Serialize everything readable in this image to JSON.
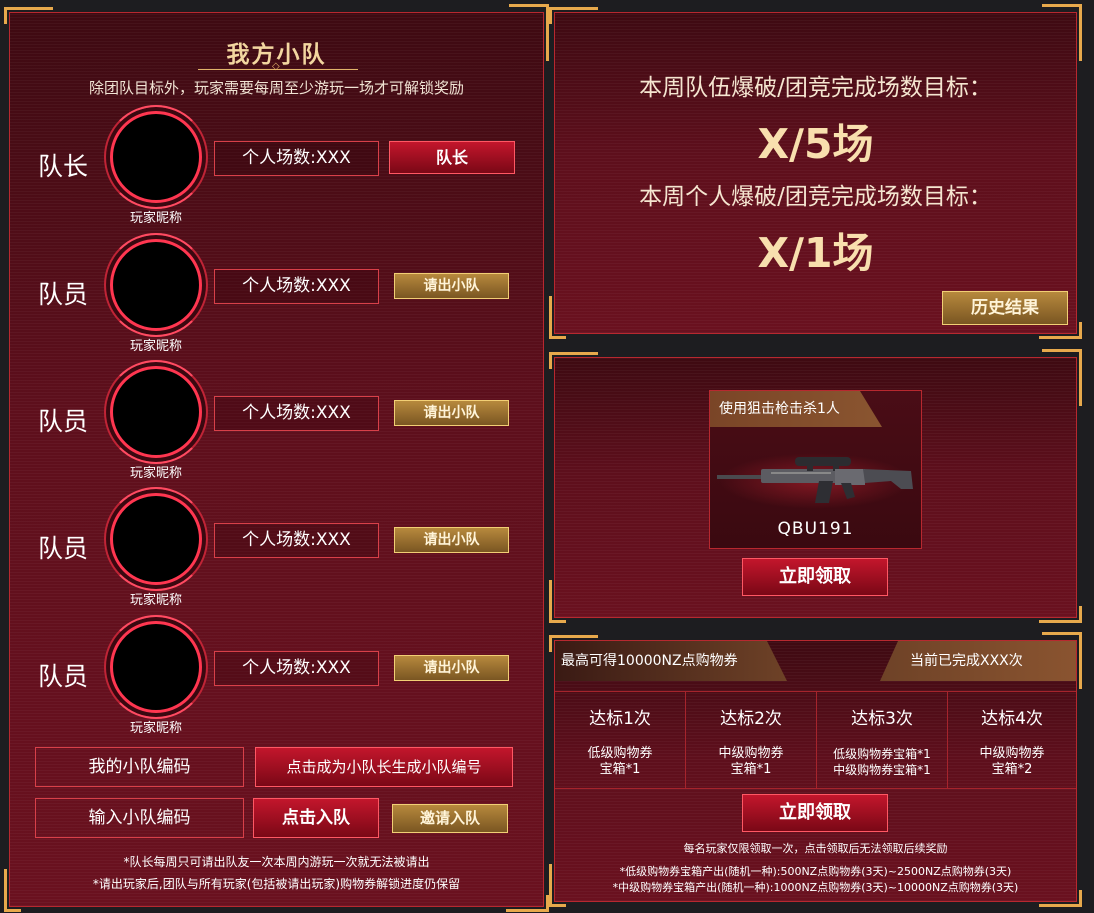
{
  "squad": {
    "title": "我方小队",
    "subtitle": "除团队目标外，玩家需要每周至少游玩一场才可解锁奖励",
    "members": [
      {
        "role": "队长",
        "nickname": "玩家昵称",
        "matches": "个人场数:XXX",
        "action": "队长"
      },
      {
        "role": "队员",
        "nickname": "玩家昵称",
        "matches": "个人场数:XXX",
        "action": "请出小队"
      },
      {
        "role": "队员",
        "nickname": "玩家昵称",
        "matches": "个人场数:XXX",
        "action": "请出小队"
      },
      {
        "role": "队员",
        "nickname": "玩家昵称",
        "matches": "个人场数:XXX",
        "action": "请出小队"
      },
      {
        "role": "队员",
        "nickname": "玩家昵称",
        "matches": "个人场数:XXX",
        "action": "请出小队"
      }
    ],
    "my_code_label": "我的小队编码",
    "generate_code_button": "点击成为小队长生成小队编号",
    "input_code_label": "输入小队编码",
    "join_button": "点击入队",
    "invite_button": "邀请入队",
    "notes": [
      "*队长每周只可请出队友一次本周内游玩一次就无法被请出",
      "*请出玩家后,团队与所有玩家(包括被请出玩家)购物券解锁进度仍保留"
    ]
  },
  "weekly_goals": {
    "team_label": "本周队伍爆破/团竞完成场数目标：",
    "team_value": "X/5场",
    "personal_label": "本周个人爆破/团竞完成场数目标：",
    "personal_value": "X/1场",
    "history_button": "历史结果"
  },
  "weapon_reward": {
    "task": "使用狙击枪击杀1人",
    "weapon_name": "QBU191",
    "claim_button": "立即领取"
  },
  "tier_rewards": {
    "max_label": "最高可得10000NZ点购物券",
    "progress_label": "当前已完成XXX次",
    "tiers": [
      {
        "title": "达标1次",
        "reward": [
          "低级购物券",
          "宝箱*1"
        ]
      },
      {
        "title": "达标2次",
        "reward": [
          "中级购物券",
          "宝箱*1"
        ]
      },
      {
        "title": "达标3次",
        "reward": [
          "低级购物券宝箱*1",
          "中级购物券宝箱*1"
        ]
      },
      {
        "title": "达标4次",
        "reward": [
          "中级购物券",
          "宝箱*2"
        ]
      }
    ],
    "claim_button": "立即领取",
    "note_main": "每名玩家仅限领取一次，点击领取后无法领取后续奖励",
    "note_low": "*低级购物券宝箱产出(随机一种):500NZ点购物券(3天)~2500NZ点购物券(3天)",
    "note_mid": "*中级购物券宝箱产出(随机一种):1000NZ点购物券(3天)~10000NZ点购物券(3天)"
  },
  "colors": {
    "panel_border": "#b8282f",
    "accent_gold": "#e7a94c",
    "button_red": "#c3162c",
    "button_gold": "#b7893d",
    "ring_red": "#ff3650"
  },
  "icons": [
    "corner-bracket",
    "avatar-ring",
    "rifle-image"
  ]
}
